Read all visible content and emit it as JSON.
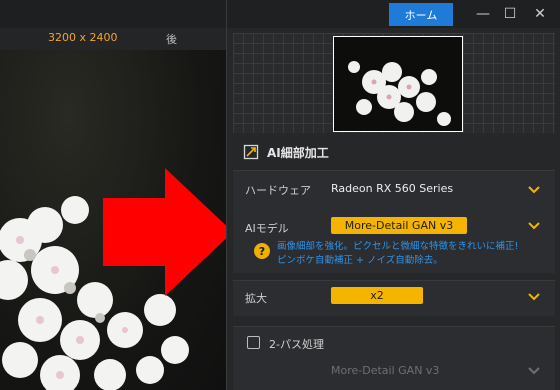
{
  "titlebar": {
    "home_label": "ホーム",
    "minimize_glyph": "—",
    "maximize_glyph": "☐",
    "close_glyph": "✕"
  },
  "preview": {
    "resolution": "3200 x 2400",
    "after_label": "後"
  },
  "section": {
    "title": "AI細部加工",
    "icon": "enhance-icon"
  },
  "settings": {
    "hardware_label": "ハードウェア",
    "hardware_value": "Radeon RX 560 Series",
    "model_label": "AIモデル",
    "model_value": "More-Detail GAN  v3",
    "desc_line1": "画像細部を強化。ピクセルと微細な特徴をきれいに補正!",
    "desc_line2": "ピンボケ自動補正 + ノイズ自動除去。",
    "scale_label": "拡大",
    "scale_value": "x2",
    "twopass_label": "2-パス処理",
    "twopass_model": "More-Detail GAN  v3"
  },
  "colors": {
    "accent_yellow": "#f5b400",
    "home_blue": "#1f7ad8",
    "desc_blue": "#2f93e8",
    "arrow_red": "#ff0000"
  }
}
